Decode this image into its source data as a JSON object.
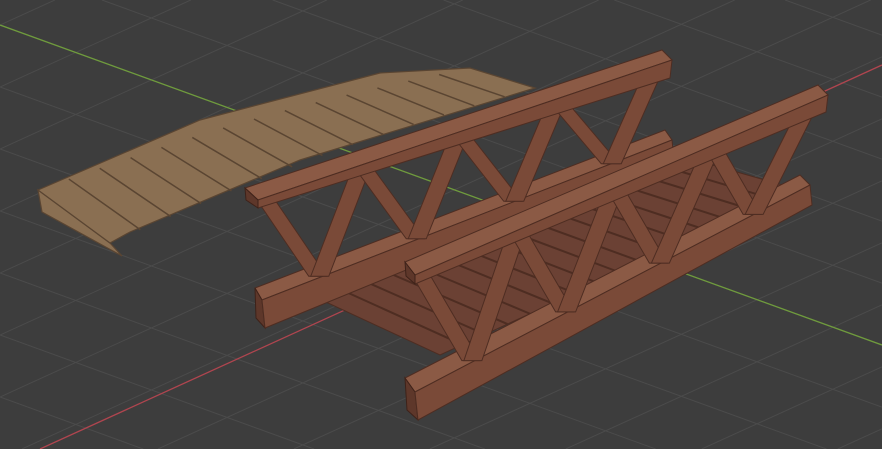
{
  "viewport": {
    "background_color": "#3d3d3d",
    "grid_color": "#4b4b4b",
    "x_axis_color": "#b0454f",
    "y_axis_color": "#6f9b3d"
  },
  "objects": [
    {
      "name": "wooden-arched-deck"
    },
    {
      "name": "truss-bridge"
    }
  ]
}
